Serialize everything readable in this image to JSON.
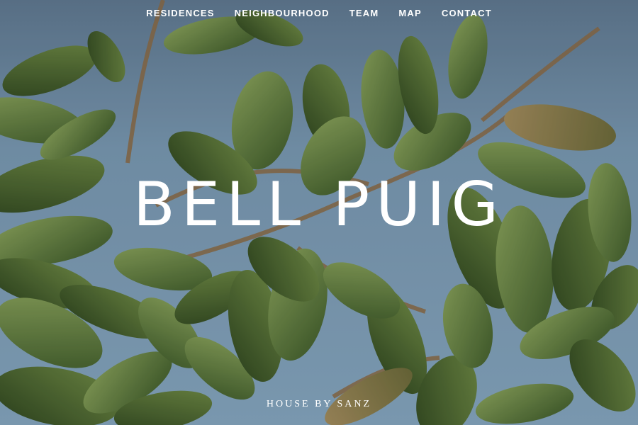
{
  "nav": {
    "items": [
      {
        "label": "RESIDENCES"
      },
      {
        "label": "NEIGHBOURHOOD"
      },
      {
        "label": "TEAM"
      },
      {
        "label": "MAP"
      },
      {
        "label": "CONTACT"
      }
    ]
  },
  "hero": {
    "title": "BELL PUIG",
    "subtitle": "HOUSE BY SANZ"
  },
  "colors": {
    "sky": "#7e9fb8",
    "leaf_dark": "#3f5a2c",
    "leaf_light": "#7f9a56",
    "text": "#ffffff"
  }
}
